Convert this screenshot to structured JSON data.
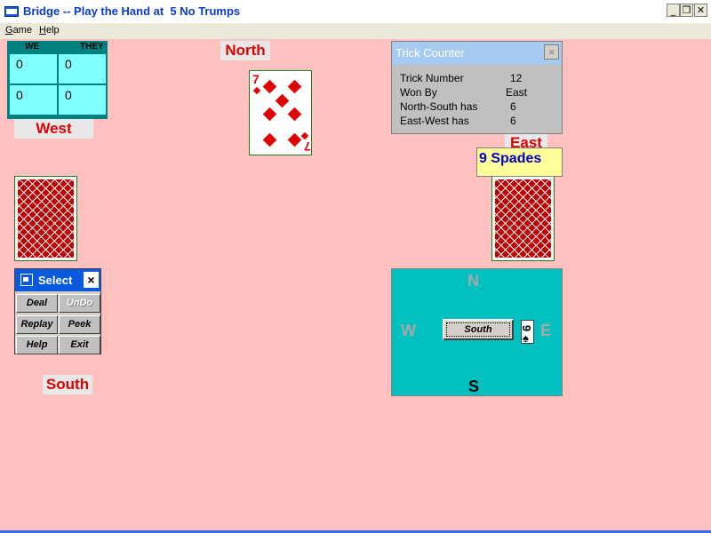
{
  "window": {
    "title": "Bridge -- Play the Hand at  5 No Trumps",
    "btn_min": "_",
    "btn_restore": "❐",
    "btn_close": "✕"
  },
  "menu": [
    "Game",
    "Help"
  ],
  "score": {
    "we_label": "WE",
    "they_label": "THEY",
    "cells": [
      "0",
      "0",
      "0",
      "0"
    ]
  },
  "positions": {
    "north": "North",
    "west": "West",
    "east": "East",
    "south": "South"
  },
  "north_card": {
    "rank": "7",
    "suit": "diamonds"
  },
  "trick_counter": {
    "title": "Trick Counter",
    "close": "×",
    "rows": [
      {
        "label": "Trick Number",
        "value": "12"
      },
      {
        "label": "Won By",
        "value": "East"
      },
      {
        "label": "North-South has",
        "value": "6"
      },
      {
        "label": "East-West has",
        "value": "6"
      }
    ]
  },
  "contract_box": "9 Spades",
  "select": {
    "title": "Select",
    "close": "×",
    "buttons": [
      "Deal",
      "UnDo",
      "Replay",
      "Peek",
      "Help",
      "Exit"
    ],
    "disabled": [
      "UnDo"
    ]
  },
  "compass": {
    "n": "N",
    "w": "W",
    "e": "E",
    "s": "S",
    "button": "South",
    "mini_card_rank": "9",
    "mini_card_suit": "♠"
  },
  "colors": {
    "background": "#ffc0c0",
    "score_cell": "#80ffff",
    "compass": "#00c0c0",
    "label_red": "#e00000",
    "contract_text": "#0000c0"
  }
}
